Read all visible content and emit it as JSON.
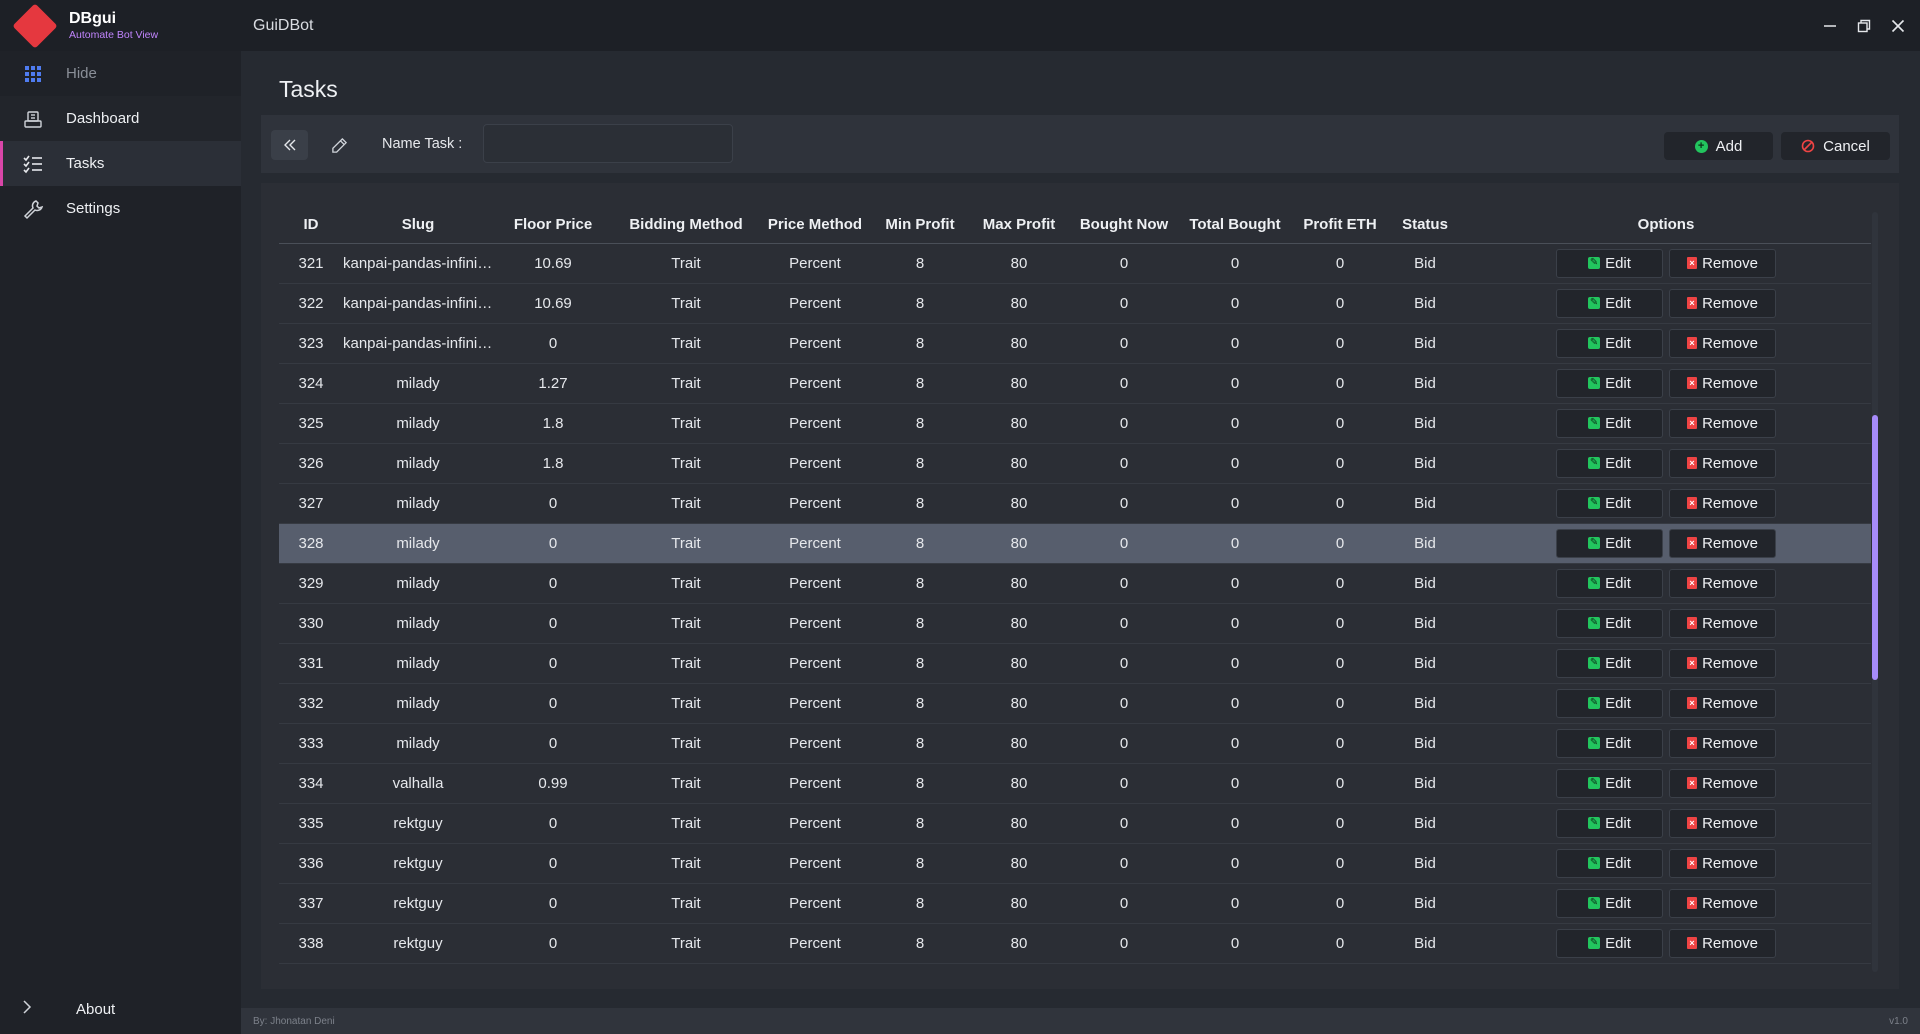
{
  "app": {
    "name": "DBgui",
    "subtitle": "Automate Bot View",
    "window_title": "GuiDBot"
  },
  "sidebar": {
    "items": [
      {
        "label": "Hide",
        "icon": "grid-icon"
      },
      {
        "label": "Dashboard",
        "icon": "dashboard-icon"
      },
      {
        "label": "Tasks",
        "icon": "tasks-list-icon"
      },
      {
        "label": "Settings",
        "icon": "wrench-icon"
      }
    ],
    "about": "About"
  },
  "page": {
    "title": "Tasks"
  },
  "toolbar": {
    "name_label": "Name Task :",
    "name_value": "",
    "add_label": "Add",
    "cancel_label": "Cancel"
  },
  "table": {
    "columns": [
      "ID",
      "Slug",
      "Floor Price",
      "Bidding Method",
      "Price Method",
      "Min Profit",
      "Max Profit",
      "Bought Now",
      "Total Bought",
      "Profit ETH",
      "Status",
      "Options"
    ],
    "edit_label": "Edit",
    "remove_label": "Remove",
    "selected_row_id": "328",
    "rows": [
      [
        "321",
        "kanpai-pandas-infinity...",
        "10.69",
        "Trait",
        "Percent",
        "8",
        "80",
        "0",
        "0",
        "0",
        "Bid"
      ],
      [
        "322",
        "kanpai-pandas-infinity...",
        "10.69",
        "Trait",
        "Percent",
        "8",
        "80",
        "0",
        "0",
        "0",
        "Bid"
      ],
      [
        "323",
        "kanpai-pandas-infinity...",
        "0",
        "Trait",
        "Percent",
        "8",
        "80",
        "0",
        "0",
        "0",
        "Bid"
      ],
      [
        "324",
        "milady",
        "1.27",
        "Trait",
        "Percent",
        "8",
        "80",
        "0",
        "0",
        "0",
        "Bid"
      ],
      [
        "325",
        "milady",
        "1.8",
        "Trait",
        "Percent",
        "8",
        "80",
        "0",
        "0",
        "0",
        "Bid"
      ],
      [
        "326",
        "milady",
        "1.8",
        "Trait",
        "Percent",
        "8",
        "80",
        "0",
        "0",
        "0",
        "Bid"
      ],
      [
        "327",
        "milady",
        "0",
        "Trait",
        "Percent",
        "8",
        "80",
        "0",
        "0",
        "0",
        "Bid"
      ],
      [
        "328",
        "milady",
        "0",
        "Trait",
        "Percent",
        "8",
        "80",
        "0",
        "0",
        "0",
        "Bid"
      ],
      [
        "329",
        "milady",
        "0",
        "Trait",
        "Percent",
        "8",
        "80",
        "0",
        "0",
        "0",
        "Bid"
      ],
      [
        "330",
        "milady",
        "0",
        "Trait",
        "Percent",
        "8",
        "80",
        "0",
        "0",
        "0",
        "Bid"
      ],
      [
        "331",
        "milady",
        "0",
        "Trait",
        "Percent",
        "8",
        "80",
        "0",
        "0",
        "0",
        "Bid"
      ],
      [
        "332",
        "milady",
        "0",
        "Trait",
        "Percent",
        "8",
        "80",
        "0",
        "0",
        "0",
        "Bid"
      ],
      [
        "333",
        "milady",
        "0",
        "Trait",
        "Percent",
        "8",
        "80",
        "0",
        "0",
        "0",
        "Bid"
      ],
      [
        "334",
        "valhalla",
        "0.99",
        "Trait",
        "Percent",
        "8",
        "80",
        "0",
        "0",
        "0",
        "Bid"
      ],
      [
        "335",
        "rektguy",
        "0",
        "Trait",
        "Percent",
        "8",
        "80",
        "0",
        "0",
        "0",
        "Bid"
      ],
      [
        "336",
        "rektguy",
        "0",
        "Trait",
        "Percent",
        "8",
        "80",
        "0",
        "0",
        "0",
        "Bid"
      ],
      [
        "337",
        "rektguy",
        "0",
        "Trait",
        "Percent",
        "8",
        "80",
        "0",
        "0",
        "0",
        "Bid"
      ],
      [
        "338",
        "rektguy",
        "0",
        "Trait",
        "Percent",
        "8",
        "80",
        "0",
        "0",
        "0",
        "Bid"
      ]
    ]
  },
  "footer": {
    "author": "By: Jhonatan Deni",
    "version": "v1.0"
  },
  "colors": {
    "accent": "#e5383f",
    "subtitle": "#c084fc",
    "active_marker": "#d946a8",
    "scrollbar": "#a78bfa",
    "add_icon": "#22c55e",
    "remove_icon": "#ef4444"
  }
}
